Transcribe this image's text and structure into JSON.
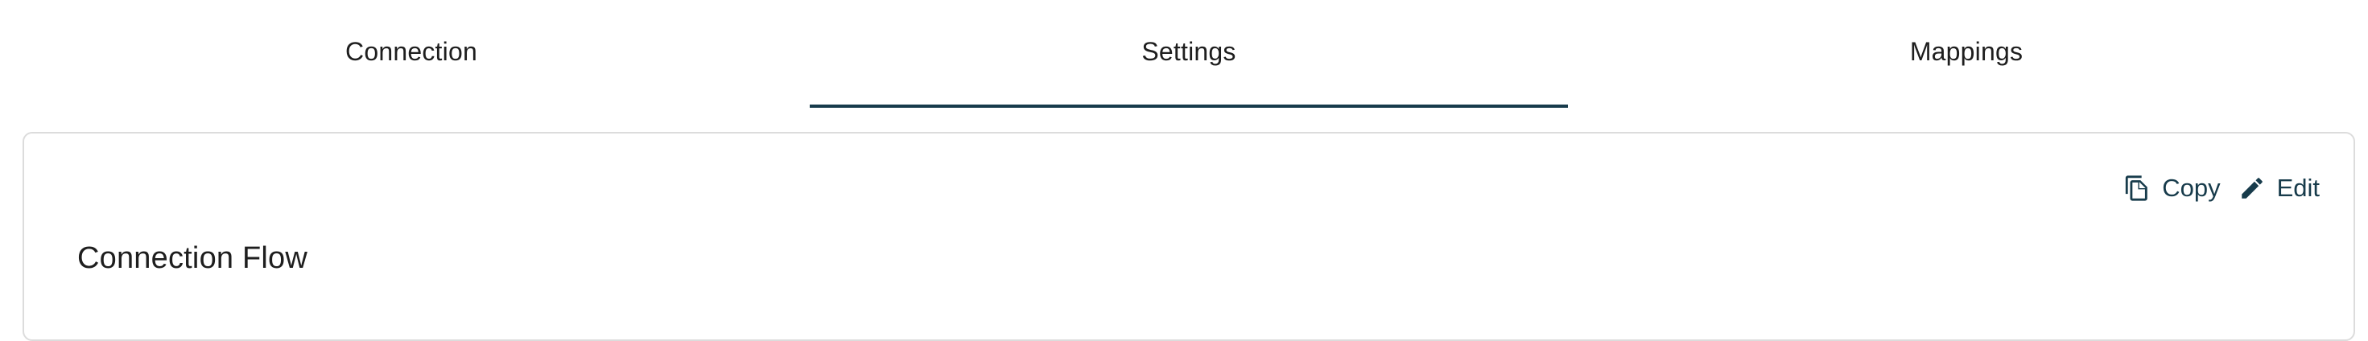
{
  "tabs": [
    {
      "label": "Connection",
      "active": false
    },
    {
      "label": "Settings",
      "active": true
    },
    {
      "label": "Mappings",
      "active": false
    }
  ],
  "card": {
    "actions": {
      "copy": {
        "label": "Copy",
        "icon": "copy-icon"
      },
      "edit": {
        "label": "Edit",
        "icon": "pencil-icon"
      }
    },
    "section_title": "Connection Flow"
  },
  "colors": {
    "accent": "#173b4b",
    "text": "#1e1e1e",
    "border": "#dcdcdc"
  }
}
